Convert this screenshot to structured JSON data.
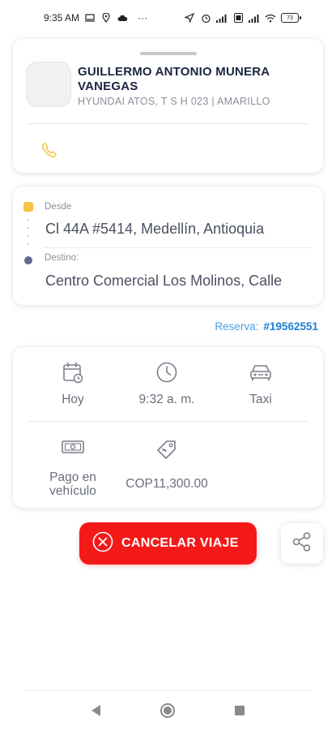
{
  "status_bar": {
    "time": "9:35 AM",
    "more": "···",
    "battery": "73",
    "icons": [
      "screen-icon",
      "location-icon",
      "cloud-icon",
      "navigation-icon",
      "alarm-icon",
      "signal-icon",
      "data-icon",
      "signal-icon",
      "wifi-icon",
      "battery-icon"
    ]
  },
  "driver": {
    "name": "GUILLERMO ANTONIO MUNERA VANEGAS",
    "vehicle": "HYUNDAI ATOS, T S H 023 | AMARILLO",
    "phone_icon": "phone-icon"
  },
  "route": {
    "origin_label": "Desde",
    "origin_address": "Cl 44A #5414, Medellín, Antioquia",
    "destination_label": "Destino:",
    "destination_address": "Centro Comercial Los Molinos, Calle"
  },
  "reserva": {
    "label": "Reserva:",
    "number": "#19562551"
  },
  "details": {
    "date": "Hoy",
    "time": "9:32 a. m.",
    "service": "Taxi",
    "payment": "Pago en vehículo",
    "fare": "COP11,300.00"
  },
  "actions": {
    "cancel_label": "CANCELAR VIAJE"
  },
  "colors": {
    "accent_yellow": "#f5c242",
    "cancel_red": "#f41919",
    "reserva_blue": "#1e7fd6",
    "title_navy": "#1b2444"
  }
}
